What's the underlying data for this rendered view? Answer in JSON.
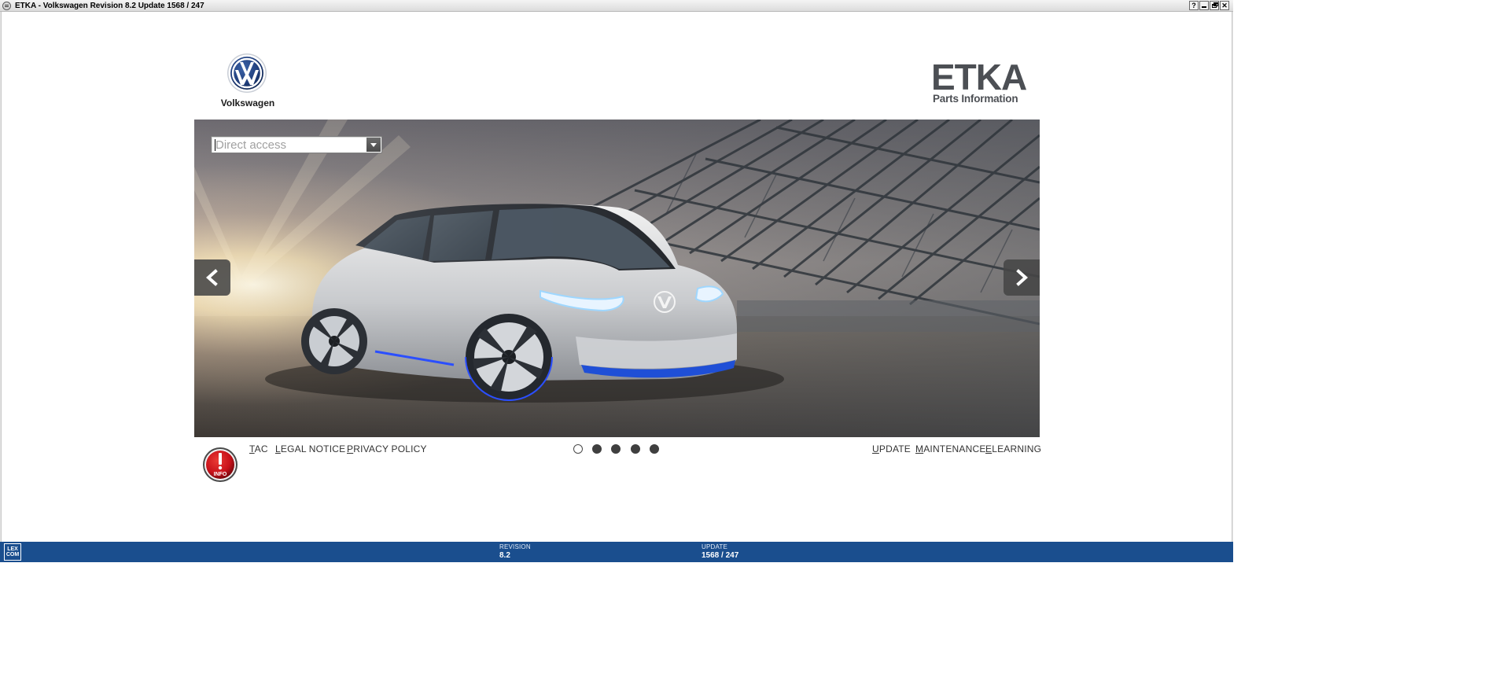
{
  "window": {
    "title": "ETKA - Volkswagen Revision 8.2 Update 1568 / 247",
    "buttons": {
      "help": "?",
      "close": "✕"
    }
  },
  "brand": {
    "name": "Volkswagen"
  },
  "product": {
    "title": "ETKA",
    "subtitle": "Parts Information"
  },
  "search": {
    "placeholder": "Direct access",
    "value": ""
  },
  "carousel": {
    "slide_count": 5,
    "active_index": 0
  },
  "footer": {
    "info_label": "INFO",
    "links_left": [
      {
        "mnemonic": "T",
        "rest": "AC"
      },
      {
        "mnemonic": "L",
        "rest": "EGAL NOTICE"
      },
      {
        "mnemonic": "P",
        "rest": "RIVACY POLICY"
      }
    ],
    "links_right": [
      {
        "mnemonic": "U",
        "rest": "PDATE"
      },
      {
        "mnemonic": "M",
        "rest": "AINTENANCE"
      },
      {
        "mnemonic": "E",
        "rest": "LEARNING"
      }
    ]
  },
  "statusbar": {
    "logo_line1": "LEX",
    "logo_line2": "COM",
    "revision_label": "REVISION",
    "revision_value": "8.2",
    "update_label": "UPDATE",
    "update_value": "1568 / 247"
  },
  "colors": {
    "statusbar_bg": "#1a4e8e",
    "vw_blue": "#1f3d7a",
    "info_red": "#c8111a"
  }
}
